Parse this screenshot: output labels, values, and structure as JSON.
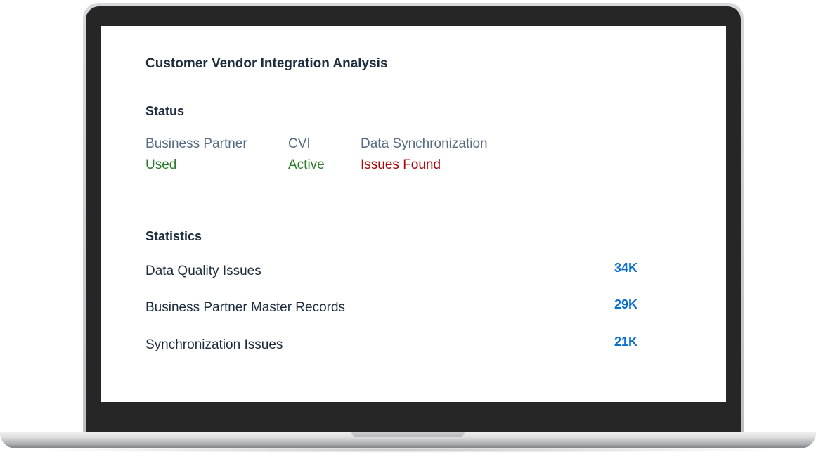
{
  "card": {
    "title": "Customer Vendor Integration Analysis"
  },
  "status": {
    "heading": "Status",
    "items": [
      {
        "label": "Business Partner",
        "value": "Used",
        "value_color": "#2b7d2b"
      },
      {
        "label": "CVI",
        "value": "Active",
        "value_color": "#2b7d2b"
      },
      {
        "label": "Data Synchronization",
        "value": "Issues Found",
        "value_color": "#aa0808"
      }
    ]
  },
  "statistics": {
    "heading": "Statistics",
    "rows": [
      {
        "label": "Data Quality Issues",
        "value": "34K"
      },
      {
        "label": "Business Partner Master Records",
        "value": "29K"
      },
      {
        "label": "Synchronization Issues",
        "value": "21K"
      }
    ]
  },
  "colors": {
    "heading": "#1d2d3e",
    "label": "#556b82",
    "positive": "#2b7d2b",
    "negative": "#aa0808",
    "link": "#0a6ed1"
  }
}
